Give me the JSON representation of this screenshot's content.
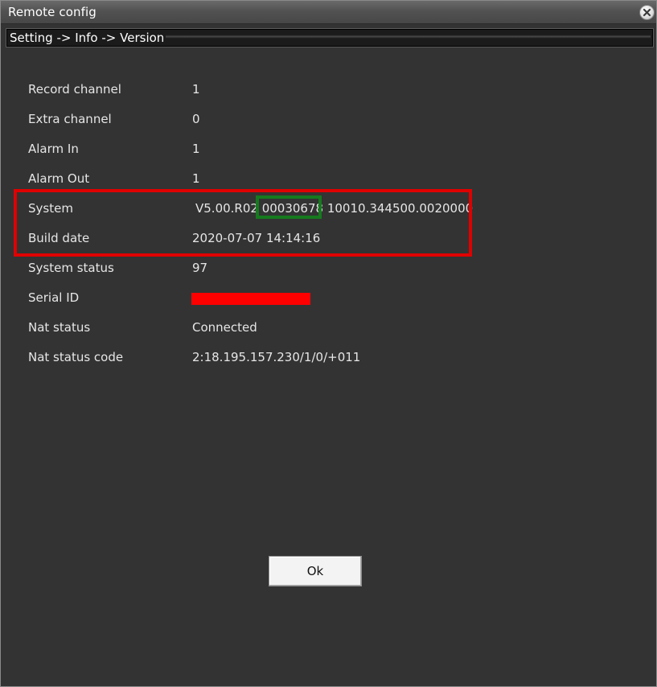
{
  "window": {
    "title": "Remote config",
    "close_icon": "close-icon"
  },
  "breadcrumb": "Setting -> Info -> Version",
  "info": [
    {
      "label": "Record channel",
      "value": "1"
    },
    {
      "label": "Extra channel",
      "value": "0"
    },
    {
      "label": "Alarm In",
      "value": "1"
    },
    {
      "label": "Alarm Out",
      "value": "1"
    },
    {
      "label": "System",
      "value_prefix": "V5.00.R02 ",
      "value_highlight": "00030678",
      "value_suffix": " 10010.344500.0020000"
    },
    {
      "label": "Build date",
      "value": "2020-07-07 14:14:16"
    },
    {
      "label": "System status",
      "value": "97"
    },
    {
      "label": "Serial ID",
      "value": ""
    },
    {
      "label": "Nat status",
      "value": "Connected"
    },
    {
      "label": "Nat status code",
      "value": "2:18.195.157.230/1/0/+011"
    }
  ],
  "annotations": {
    "red_box_color": "#e00000",
    "green_box_color": "#167a1e",
    "redaction_color": "#ff0000"
  },
  "ok_button": "Ok"
}
